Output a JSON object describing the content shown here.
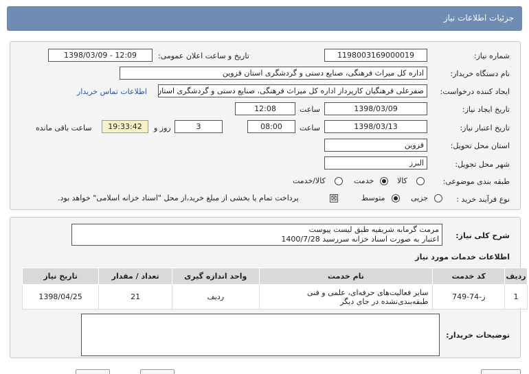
{
  "header": {
    "title": "جزئیات اطلاعات نیاز"
  },
  "form": {
    "need_number": {
      "label": "شماره نیاز:",
      "value": "1198003169000019"
    },
    "announce": {
      "label": "تاریخ و ساعت اعلان عمومی:",
      "value": "1398/03/09 - 12:09"
    },
    "buyer_org": {
      "label": "نام دستگاه خریدار:",
      "value": "اداره کل میراث فرهنگی، صنایع دستی و گردشگری استان قزوین"
    },
    "creator": {
      "label": "ایجاد کننده درخواست:",
      "value": "صفرعلی فرهنگیان کارپرداز اداره کل میراث فرهنگی، صنایع دستی و گردشگری استان قزوین",
      "contact_link": "اطلاعات تماس خریدار"
    },
    "create_date": {
      "label": "تاریخ ایجاد نیاز:",
      "date": "1398/03/09",
      "time_label": "ساعت",
      "time": "12:08"
    },
    "validity": {
      "label": "تاریخ اعتبار نیاز:",
      "date": "1398/03/13",
      "time_label": "ساعت",
      "time": "08:00",
      "days": "3",
      "days_label": "روز و",
      "remaining": "19:33:42",
      "remaining_label": "ساعت باقی مانده"
    },
    "province": {
      "label": "استان محل تحویل:",
      "value": "قزوین"
    },
    "city": {
      "label": "شهر محل تحویل:",
      "value": "البرز"
    },
    "category": {
      "label": "طبقه بندی موضوعی:",
      "options": [
        "کالا",
        "خدمت",
        "کالا/خدمت"
      ],
      "selected": "خدمت"
    },
    "process": {
      "label": "نوع فرآیند خرید :",
      "options": [
        "جزیی",
        "متوسط"
      ],
      "selected": "متوسط",
      "payment_note": "پرداخت تمام یا بخشی از مبلغ خرید،از محل \"اسناد خزانه اسلامی\" خواهد بود."
    }
  },
  "description": {
    "label": "شرح کلی نیاز:",
    "line1": "مرمت گرمابه شریفیه طبق لیست پیوست",
    "line2": "اعتبار به صورت اسناد خزانه سررسید 1400/7/28"
  },
  "services": {
    "section_title": "اطلاعات خدمات مورد نیاز",
    "columns": [
      "ردیف",
      "کد خدمت",
      "نام خدمت",
      "واحد اندازه گیری",
      "تعداد / مقدار",
      "تاریخ نیاز"
    ],
    "rows": [
      {
        "row": "1",
        "code": "ز-74-749",
        "name": "سایر فعالیت‌های حرفه‌ای، علمی و فنی طبقه‌بندی‌نشده در جای دیگر",
        "unit": "ردیف",
        "qty": "21",
        "date": "1398/04/25"
      }
    ]
  },
  "buyer_notes": {
    "label": "توضیحات خریدار:",
    "value": ""
  }
}
